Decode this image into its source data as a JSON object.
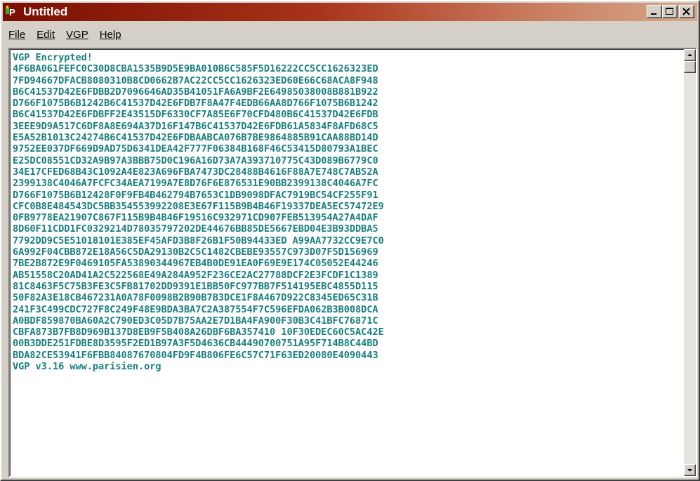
{
  "window": {
    "title": "Untitled"
  },
  "menu": {
    "file": "File",
    "edit": "Edit",
    "vgp": "VGP",
    "help": "Help"
  },
  "editor": {
    "lines": [
      "VGP Encrypted!",
      "4F6BA061FEFC0C30D8CBA1535B9D5E9BA010B6C585F5D16222CC5CC1626323ED",
      "7FD94667DFACB8080310B8CD0662B7AC22CC5CC1626323ED60E66C68ACA8F948",
      "B6C41537D42E6FDBB2D7096646AD35B41051FA6A9BF2E64985038008B881B922",
      "D766F1075B6B1242B6C41537D42E6FDB7F8A47F4EDB66AA8D766F1075B6B1242",
      "B6C41537D42E6FDBFF2E43515DF6330CF7A85E6F70CFD480B6C41537D42E6FDB",
      "3EEE9D9A517C6DF8A8E694A37D16F147B6C41537D42E6FDB61A5834F8AFD68C5",
      "E5A52B1013C24274B6C41537D42E6FDBAABCA076B7BE9864885B91CAA88BD14D",
      "9752EE037DF669D9AD75D6341DEA42F777F06384B168F46C53415D80793A1BEC",
      "E25DC08551CD32A9B97A3BBB75D0C196A16D73A7A393710775C43D089B6779C0",
      "34E17CFED68B43C1092A4E823A696FBA7473DC28488B4616F88A7E748C7AB52A",
      "2399138C4046A7FCFC34AEA7199A7E8D76F6E876531E90BB2399138C4046A7FC",
      "D766F1075B6B12428F0F9FB4B462794B7653C1DB9098DFAC7919BC54CF255F91",
      "CFC0B8E484543DC5BB354553992208E3E67F115B9B4B46F19337DEA5EC57472E9",
      "0FB9778EA21907C867F115B9B4B46F19516C932971CD907FEB513954A27A4DAF",
      "8D60F11CDD1FC0329214D78035797202DE44676BB85DE5667EBD04E3B93DDBA5",
      "7792DD9C5E51018101E385EF45AFD3B8F26B1F50B94433ED A99AA7732CC9E7C0",
      "6A992F04CBB872E18A56C5DA29130B2C5C1482CBEBE93557C973D07F5D156969",
      "7BE2B872E9F0469105FA53890344967EB4B0DE91EA0F69E9E174C05052E44246",
      "AB51558C20AD41A2C522568E49A284A952F236CE2AC27788DCF2E3FCDF1C1389",
      "81C8463F5C75B3FE3C5FB81702DD9391E1BB50FC977BB7F514195EBC4855D115",
      "50F82A3E18CB467231A0A78F0098B2B90B7B3DCE1F8A467D922C8345ED65C31B",
      "241F3C499CDC727F8C249F48E9BDA3BA7C2A387554F7C596EFDA062B3B008DCA",
      "A0BDF859870BA60A2C790ED3C05D7B75AA2E7D1BA4FA900F30B3C41BFC76871C",
      "CBFA873B7FB8D969B137D8EB9F5B408A26DBF6BA357410 10F30EDEC60C5AC42E",
      "00B3DDE251FDBE8D3595F2ED1B97A3F5D4636CB44490700751A95F714B8C44BD",
      "BDA82CE53941F6FBB84087670804FD9F4B806FE6C57C71F63ED20080E4090443",
      "VGP v3.16 www.parisien.org"
    ]
  },
  "colors": {
    "titlebar_start": "#7a0e00",
    "titlebar_end": "#d8a88c",
    "text": "#1a7f80",
    "face": "#d4d0c8"
  },
  "icons": {
    "app": "vgp-app-icon",
    "minimize": "minimize-icon",
    "maximize": "maximize-icon",
    "close": "close-icon",
    "scroll_up": "scroll-up-arrow-icon",
    "scroll_down": "scroll-down-arrow-icon"
  }
}
